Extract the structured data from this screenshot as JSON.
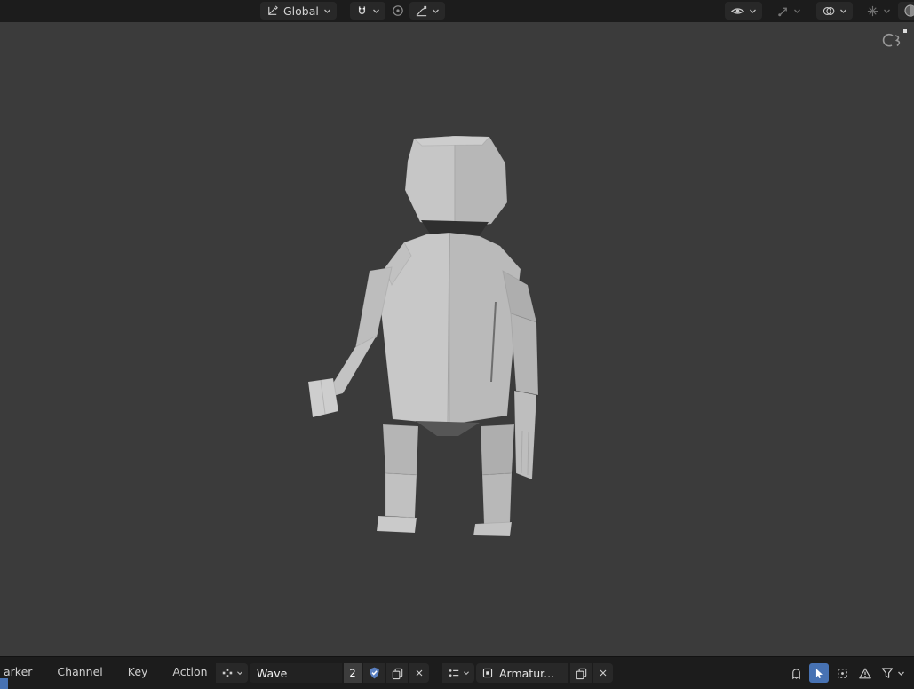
{
  "colors": {
    "accent": "#4772b3",
    "header_bg": "#1c1c1c",
    "viewport_bg": "#3b3b3b",
    "button_bg": "#282828",
    "model_light": "#c8c8c8",
    "model_dark": "#b0b0b0"
  },
  "viewport_header": {
    "transform_orientation_label": "Global"
  },
  "viewport": {
    "model_description": "low-poly humanoid character seen from behind"
  },
  "dopesheet_header": {
    "menus": [
      "arker",
      "Channel",
      "Key",
      "Action"
    ],
    "action_name": "Wave",
    "action_users": "2",
    "slot_name": "Armatur..."
  },
  "icons": {
    "transform_orientation": "axis-grid",
    "snapping": "magnet",
    "proportional_editing": "circle-dot",
    "falloff": "curve",
    "show_gizmos": "eye",
    "transform_gizmo": "move-arrow",
    "show_overlays": "two-circles",
    "toggle_xray": "asterisk",
    "shading": "sphere",
    "fake_user": "shield-check",
    "duplicate": "copy-pages",
    "unlink": "x-cross",
    "only_selected": "cursor-arrow",
    "show_hidden": "ghost",
    "frame_channels": "dashed-box",
    "show_errors": "warning-triangle",
    "filter": "funnel"
  }
}
